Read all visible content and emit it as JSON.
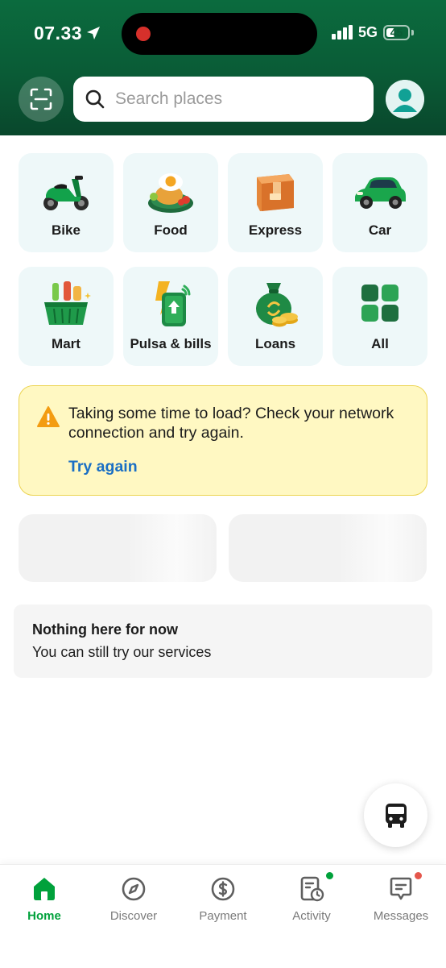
{
  "status_bar": {
    "time": "07.33",
    "network": "5G",
    "battery": "45",
    "battery_level": 0.45,
    "location-icon": "location-arrow-icon"
  },
  "header": {
    "search_placeholder": "Search places",
    "scan_icon": "scan-icon",
    "avatar_icon": "user-avatar-icon",
    "bg_color": "#0a5b36"
  },
  "services": [
    {
      "label": "Bike",
      "icon": "motorbike-icon"
    },
    {
      "label": "Food",
      "icon": "food-plate-icon"
    },
    {
      "label": "Express",
      "icon": "package-box-icon"
    },
    {
      "label": "Car",
      "icon": "car-icon"
    },
    {
      "label": "Mart",
      "icon": "shopping-basket-icon"
    },
    {
      "label": "Pulsa & bills",
      "icon": "phone-bill-icon"
    },
    {
      "label": "Loans",
      "icon": "money-bag-icon"
    },
    {
      "label": "All",
      "icon": "grid-icon"
    }
  ],
  "alert": {
    "message": "Taking some time to load? Check your network connection and try again.",
    "action": "Try again",
    "icon": "warning-icon"
  },
  "empty_state": {
    "title": "Nothing here for now",
    "subtitle": "You can still try our services"
  },
  "fab": {
    "icon": "bus-icon"
  },
  "bottom_nav": {
    "items": [
      {
        "label": "Home",
        "icon": "home-icon",
        "active": true
      },
      {
        "label": "Discover",
        "icon": "compass-icon",
        "active": false
      },
      {
        "label": "Payment",
        "icon": "dollar-circle-icon",
        "active": false
      },
      {
        "label": "Activity",
        "icon": "activity-icon",
        "active": false,
        "badge_color": "#00a13b"
      },
      {
        "label": "Messages",
        "icon": "chat-icon",
        "active": false,
        "badge_color": "#e5574c"
      }
    ]
  },
  "colors": {
    "accent": "#00a13b",
    "link": "#1a6fc4",
    "alert_bg": "#fff8c2"
  }
}
